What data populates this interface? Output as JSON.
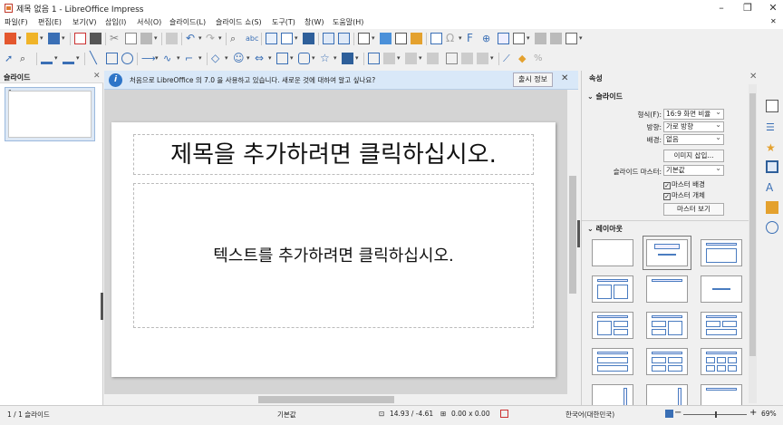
{
  "window": {
    "title": "제목 없음 1 - LibreOffice Impress",
    "minimize": "–",
    "maximize": "❐",
    "close": "✕"
  },
  "menu": [
    "파일(F)",
    "편집(E)",
    "보기(V)",
    "삽입(I)",
    "서식(O)",
    "슬라이드(L)",
    "슬라이드 쇼(S)",
    "도구(T)",
    "창(W)",
    "도움말(H)"
  ],
  "menu_close": "✕",
  "slides_pane": {
    "title": "슬라이드",
    "close": "✕",
    "thumb_number": "1"
  },
  "infobar": {
    "message": "처음으로 LibreOffice 의 7.0 을 사용하고 있습니다. 새로운 것에 대하여 알고 싶나요?",
    "button": "출시 정보",
    "close": "✕"
  },
  "slide": {
    "title_placeholder": "제목을 추가하려면 클릭하십시오.",
    "body_placeholder": "텍스트를 추가하려면 클릭하십시오."
  },
  "sidebar": {
    "title": "속성",
    "close": "✕",
    "slide_deck": {
      "title": "슬라이드",
      "format_label": "형식(F):",
      "format_value": "16:9 화면 비율",
      "orientation_label": "방향:",
      "orientation_value": "가로 방향",
      "background_label": "배경:",
      "background_value": "없음",
      "insert_image_button": "이미지 삽입...",
      "master_label": "슬라이드 마스터:",
      "master_value": "기본값",
      "master_background": "마스터 배경",
      "master_objects": "마스터 개체",
      "master_view_button": "마스터 보기"
    },
    "layouts_deck": {
      "title": "레이아웃"
    }
  },
  "status": {
    "slide_count": "1 / 1 슬라이드",
    "master": "기본값",
    "position": "14.93 / -4.61",
    "size": "0.00 x 0.00",
    "language": "한국어(대한민국)",
    "zoom": "69%"
  },
  "colors": {
    "accent": "#2e75c8",
    "infobar": "#d9e8f8"
  }
}
